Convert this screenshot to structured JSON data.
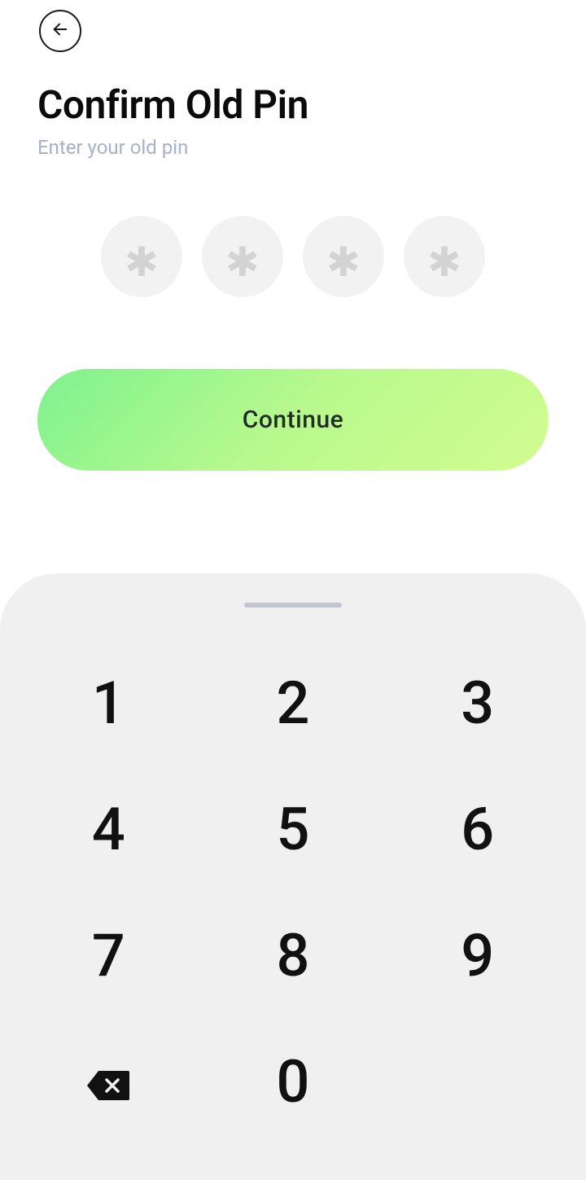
{
  "header": {
    "title": "Confirm Old Pin",
    "subtitle": "Enter your old pin"
  },
  "pin": {
    "placeholder": "✱",
    "count": 4
  },
  "actions": {
    "continue_label": "Continue"
  },
  "keypad": {
    "keys": [
      "1",
      "2",
      "3",
      "4",
      "5",
      "6",
      "7",
      "8",
      "9",
      "backspace",
      "0",
      "blank"
    ]
  }
}
